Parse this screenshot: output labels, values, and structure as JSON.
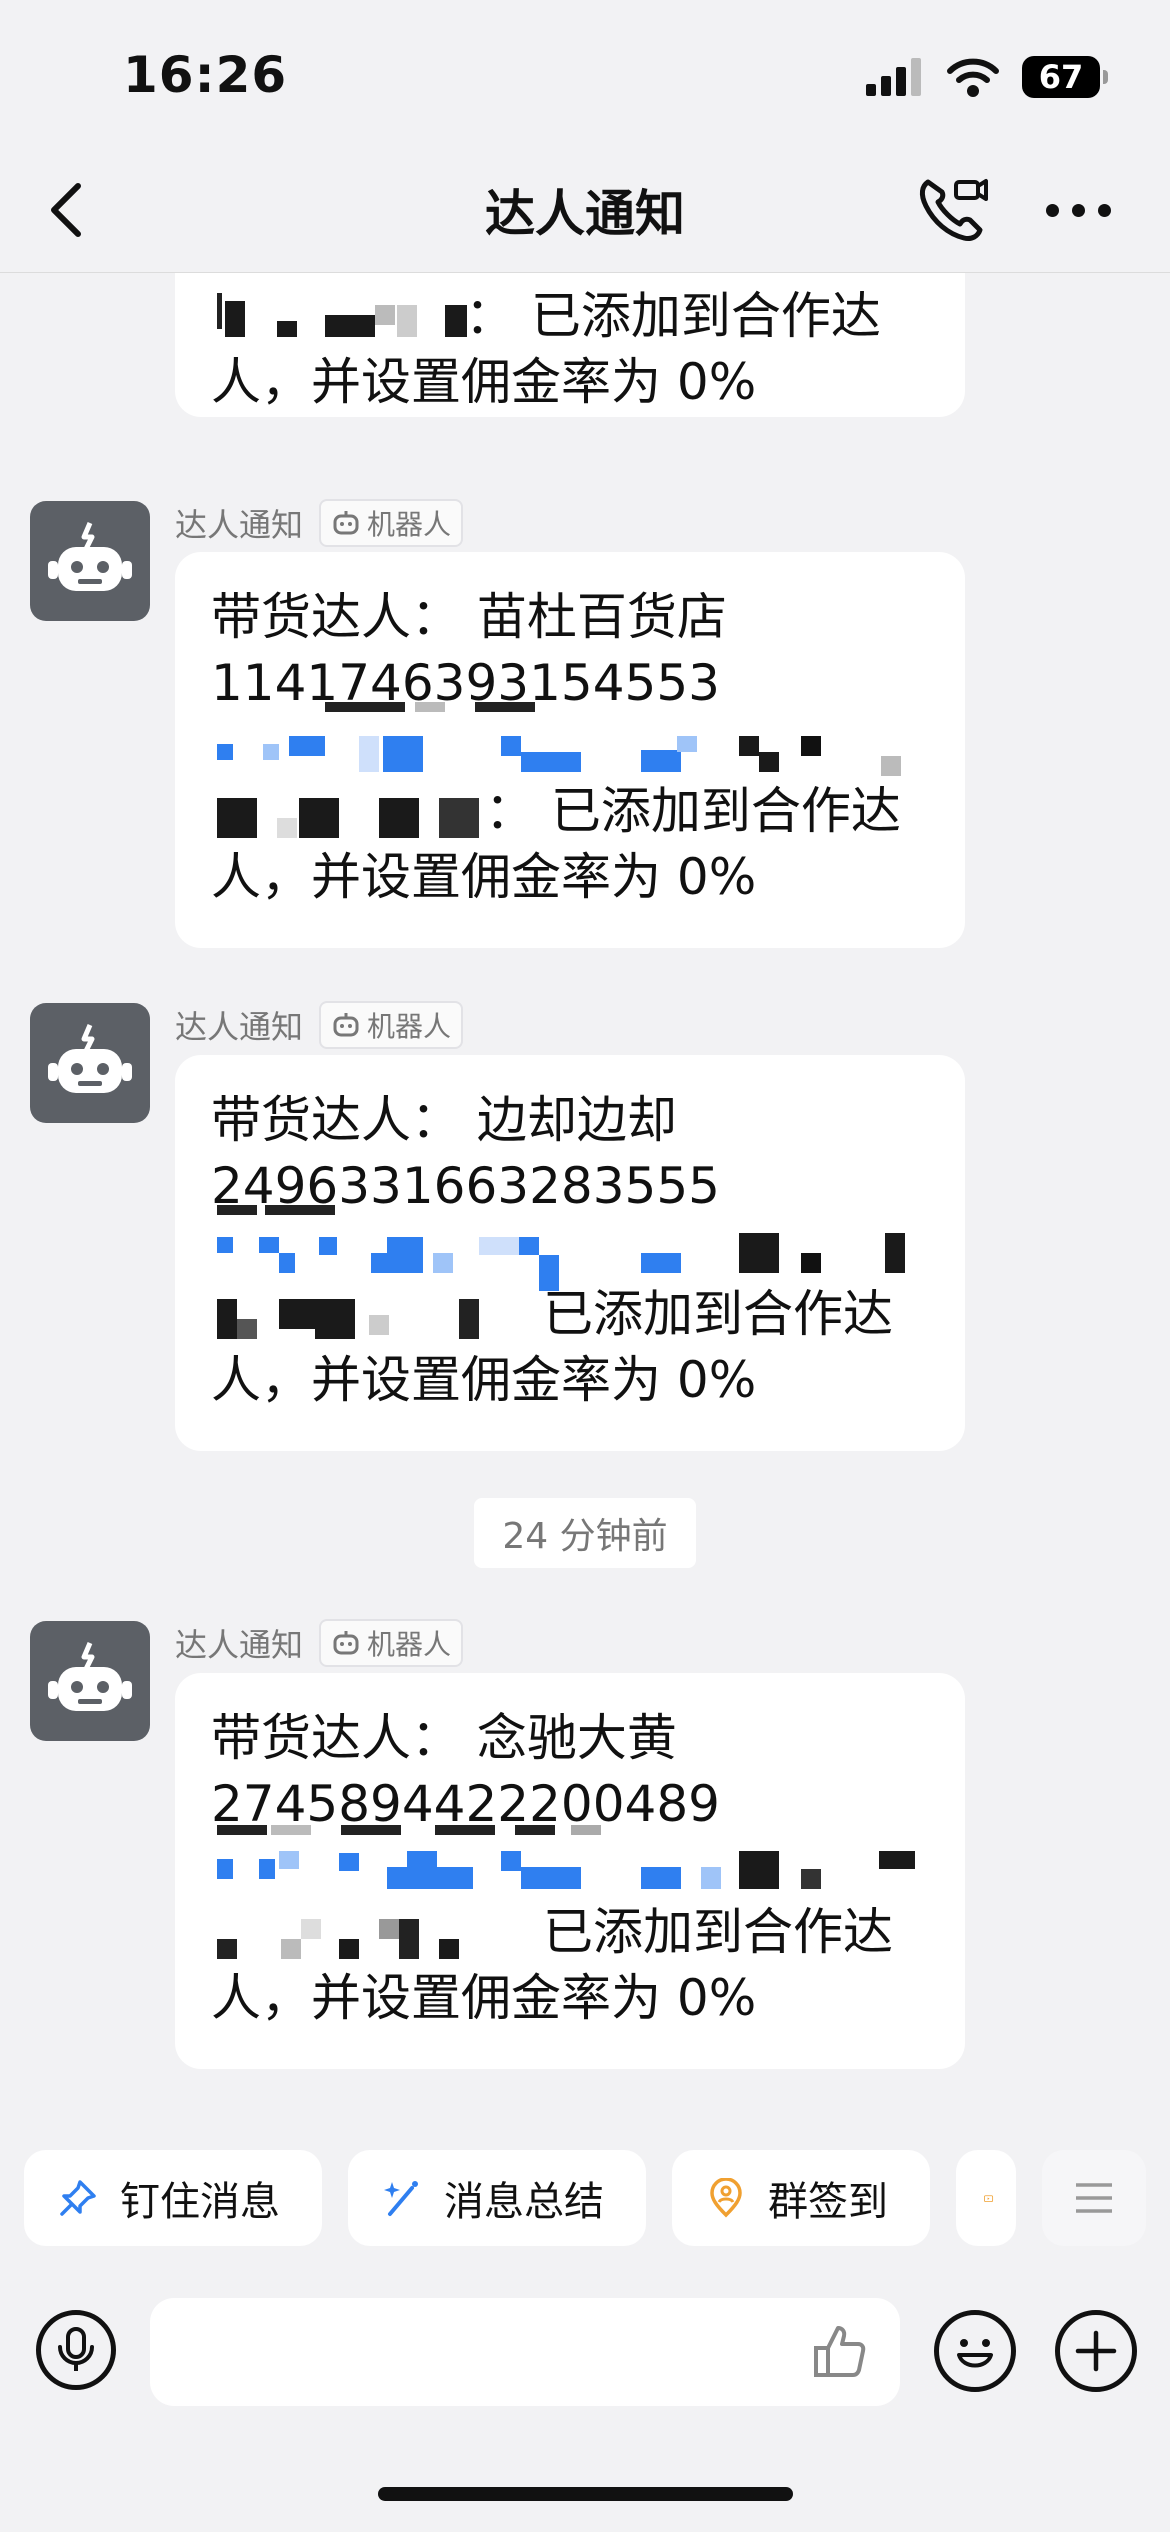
{
  "status": {
    "time": "16:26",
    "battery": "67"
  },
  "nav": {
    "title": "达人通知"
  },
  "partial_message": {
    "line1_tail": "：  已添加到合作达",
    "line2": "人，并设置佣金率为 0%"
  },
  "messages": [
    {
      "sender": "达人通知",
      "badge": "机器人",
      "line1": "带货达人：  苗杜百货店",
      "line2": "1141746393154553",
      "line4_tail": "：  已添加到合作达",
      "line5": "人，并设置佣金率为 0%"
    },
    {
      "sender": "达人通知",
      "badge": "机器人",
      "line1": "带货达人：  边却边却",
      "line2": "2496331663283555",
      "line4_tail": "已添加到合作达",
      "line5": "人，并设置佣金率为 0%"
    },
    {
      "sender": "达人通知",
      "badge": "机器人",
      "line1": "带货达人：  念驰大黄",
      "line2": "2745894422200489",
      "line4_tail": "已添加到合作达",
      "line5": "人，并设置佣金率为 0%"
    }
  ],
  "time_divider": "24 分钟前",
  "quick_actions": [
    {
      "label": "钉住消息",
      "icon": "pin-icon"
    },
    {
      "label": "消息总结",
      "icon": "magic-wand-icon"
    },
    {
      "label": "群签到",
      "icon": "location-checkin-icon"
    }
  ],
  "colors": {
    "accent_blue": "#2f7ff0",
    "orange": "#f0a030",
    "avatar_gray": "#5c6066"
  }
}
